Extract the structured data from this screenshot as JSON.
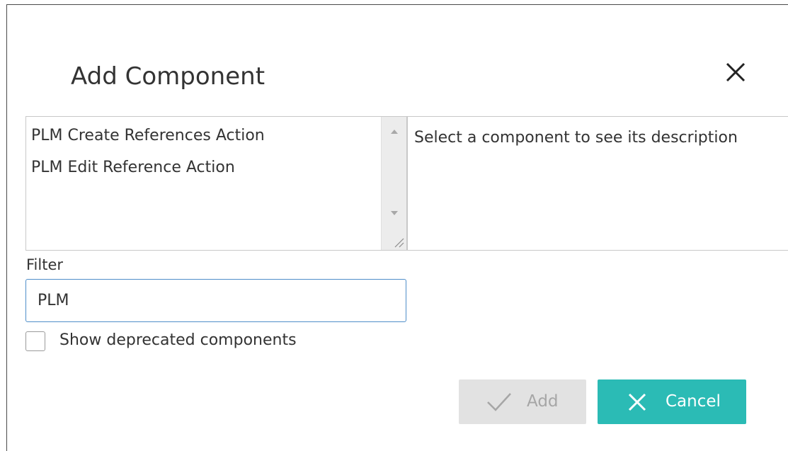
{
  "dialog": {
    "title": "Add Component",
    "close_icon": "close-icon"
  },
  "component_list": {
    "items": [
      {
        "label": "PLM Create References Action"
      },
      {
        "label": "PLM Edit Reference Action"
      }
    ],
    "scroll_up_icon": "triangle-up-icon",
    "scroll_down_icon": "triangle-down-icon",
    "resize_icon": "resize-grip-icon"
  },
  "description": {
    "text": "Select a component to see its description"
  },
  "filter": {
    "label": "Filter",
    "value": "PLM"
  },
  "deprecated": {
    "label": "Show deprecated components",
    "checked": false
  },
  "buttons": {
    "add": {
      "label": "Add",
      "icon": "checkmark-icon",
      "enabled": false
    },
    "cancel": {
      "label": "Cancel",
      "icon": "close-icon"
    }
  },
  "colors": {
    "accent": "#2bbbb5",
    "disabled_bg": "#e2e2e2",
    "focus_border": "#4f8ec9"
  }
}
